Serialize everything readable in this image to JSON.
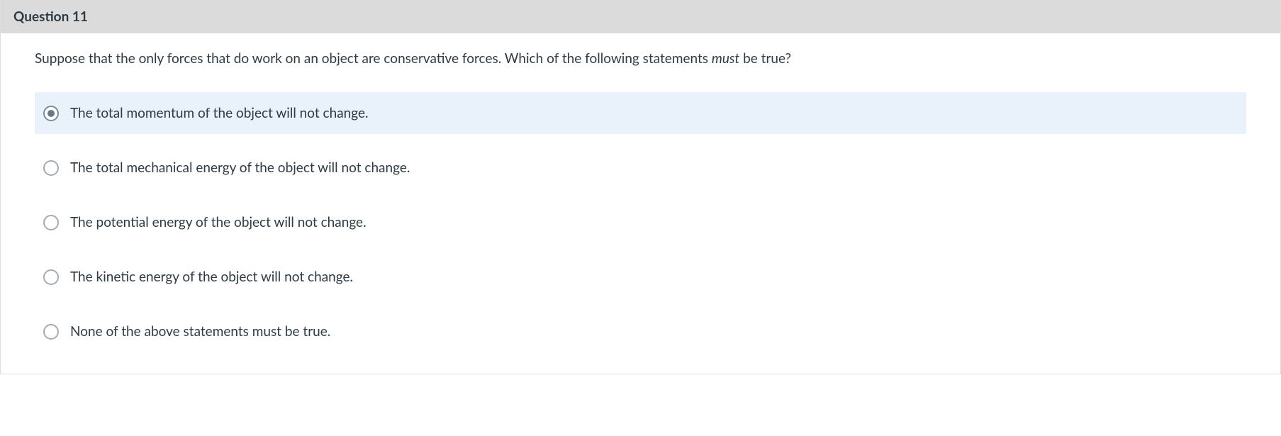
{
  "question": {
    "header": "Question 11",
    "prompt_before_em": "Suppose that the only forces that do work on an object are conservative forces. Which of the following statements ",
    "prompt_em": "must",
    "prompt_after_em": " be true?",
    "options": [
      {
        "label": "The total momentum of the object will not change.",
        "selected": true
      },
      {
        "label": "The total mechanical energy of the object will not change.",
        "selected": false
      },
      {
        "label": "The potential energy of the object will not change.",
        "selected": false
      },
      {
        "label": "The kinetic energy of the object will not change.",
        "selected": false
      },
      {
        "label": "None of the above statements must be true.",
        "selected": false
      }
    ]
  }
}
